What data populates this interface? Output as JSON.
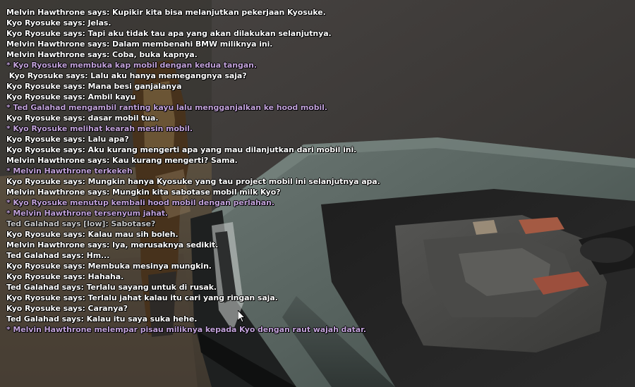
{
  "chat": {
    "lines": [
      {
        "text": "Melvin Hawthrone says: Kupikir kita bisa melanjutkan pekerjaan Kyosuke.",
        "kind": "say"
      },
      {
        "text": "Kyo Ryosuke says: Jelas.",
        "kind": "say"
      },
      {
        "text": "Kyo Ryosuke says: Tapi aku tidak tau apa yang akan dilakukan selanjutnya.",
        "kind": "say"
      },
      {
        "text": "Melvin Hawthrone says: Dalam membenahi BMW miliknya ini.",
        "kind": "say"
      },
      {
        "text": "Melvin Hawthrone says: Coba, buka kapnya.",
        "kind": "say"
      },
      {
        "text": "* Kyo Ryosuke membuka kap mobil dengan kedua tangan.",
        "kind": "me"
      },
      {
        "text": " Kyo Ryosuke says: Lalu aku hanya memegangnya saja?",
        "kind": "say"
      },
      {
        "text": "Kyo Ryosuke says: Mana besi ganjalanya",
        "kind": "say"
      },
      {
        "text": "Kyo Ryosuke says: Ambil kayu",
        "kind": "say"
      },
      {
        "text": "* Ted Galahad mengambil ranting kayu lalu mengganjalkan ke hood mobil.",
        "kind": "me"
      },
      {
        "text": "Kyo Ryosuke says: dasar mobil tua.",
        "kind": "say"
      },
      {
        "text": "* Kyo Ryosuke melihat kearah mesin mobil.",
        "kind": "me"
      },
      {
        "text": "Kyo Ryosuke says: Lalu apa?",
        "kind": "say"
      },
      {
        "text": "Kyo Ryosuke says: Aku kurang mengerti apa yang mau dilanjutkan dari mobil ini.",
        "kind": "say"
      },
      {
        "text": "Melvin Hawthrone says: Kau kurang mengerti? Sama.",
        "kind": "say"
      },
      {
        "text": "* Melvin Hawthrone terkekeh",
        "kind": "me"
      },
      {
        "text": "Kyo Ryosuke says: Mungkin hanya Kyosuke yang tau project mobil ini selanjutnya apa.",
        "kind": "say"
      },
      {
        "text": "Melvin Hawthrone says: Mungkin kita sabotase mobil milk Kyo?",
        "kind": "say"
      },
      {
        "text": "* Kyo Ryosuke menutup kembali hood mobil dengan perlahan.",
        "kind": "me"
      },
      {
        "text": "* Melvin Hawthrone tersenyum jahat.",
        "kind": "me"
      },
      {
        "text": "Ted Galahad says [low]: Sabotase?",
        "kind": "low"
      },
      {
        "text": "Kyo Ryosuke says: Kalau mau sih boleh.",
        "kind": "say"
      },
      {
        "text": "Melvin Hawthrone says: Iya, merusaknya sedikit.",
        "kind": "say"
      },
      {
        "text": "Ted Galahad says: Hm...",
        "kind": "say"
      },
      {
        "text": "Kyo Ryosuke says: Membuka mesinya mungkin.",
        "kind": "say"
      },
      {
        "text": "Kyo Ryosuke says: Hahaha.",
        "kind": "say"
      },
      {
        "text": "Ted Galahad says: Terlalu sayang untuk di rusak.",
        "kind": "say"
      },
      {
        "text": "Kyo Ryosuke says: Terlalu jahat kalau itu cari yang ringan saja.",
        "kind": "say"
      },
      {
        "text": "Kyo Ryosuke says: Caranya?",
        "kind": "say"
      },
      {
        "text": "Ted Galahad says: Kalau itu saya suka hehe.",
        "kind": "say"
      },
      {
        "text": "* Melvin Hawthrone melempar pisau miliknya kepada Kyo dengan raut wajah datar.",
        "kind": "me"
      }
    ]
  },
  "colors": {
    "say": "#ffffff",
    "me": "#c2a2da",
    "low": "#c8c8c8",
    "car_body": "#5b6663",
    "background": "#3a3836"
  },
  "icons": {
    "cursor": "mouse-cursor-icon"
  }
}
